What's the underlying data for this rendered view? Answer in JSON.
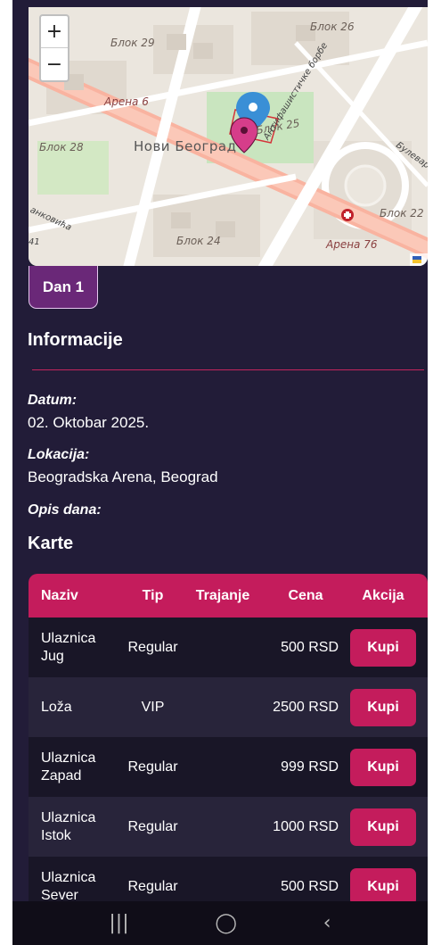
{
  "map": {
    "labels": {
      "blok29": "Блок 29",
      "blok26": "Блок 26",
      "blok28": "Блок 28",
      "blok24": "Блок 24",
      "blok22": "Блок 22",
      "blok25": "Блок 25",
      "arena6": "Арена 6",
      "arena76": "Арена 76",
      "novi_beograd": "Нови Београд",
      "antifasisticke": "Антифашистичке борбе",
      "bulevar_zorana": "Булевар зо",
      "jankovica": "анковића",
      "num41": "41"
    },
    "zoom_in": "+",
    "zoom_out": "−",
    "colors": {
      "marker_blue": "#3a8fd6",
      "marker_pink": "#d63d8a",
      "road": "#f9b3a0"
    }
  },
  "day_tab": {
    "label": "Dan 1"
  },
  "info": {
    "title": "Informacije",
    "date_label": "Datum:",
    "date_value": "02. Oktobar 2025.",
    "location_label": "Lokacija:",
    "location_value": "Beogradska Arena, Beograd",
    "description_label": "Opis dana:"
  },
  "tickets": {
    "title": "Karte",
    "columns": [
      "Naziv",
      "Tip",
      "Trajanje",
      "Cena",
      "Akcija"
    ],
    "rows": [
      {
        "name_1": "Ulaznica",
        "name_2": "Jug",
        "tip": "Regular",
        "trajanje": "",
        "cena": "500 RSD",
        "action": "Kupi"
      },
      {
        "name_1": "Loža",
        "name_2": "",
        "tip": "VIP",
        "trajanje": "",
        "cena": "2500 RSD",
        "action": "Kupi"
      },
      {
        "name_1": "Ulaznica",
        "name_2": "Zapad",
        "tip": "Regular",
        "trajanje": "",
        "cena": "999 RSD",
        "action": "Kupi"
      },
      {
        "name_1": "Ulaznica",
        "name_2": "Istok",
        "tip": "Regular",
        "trajanje": "",
        "cena": "1000 RSD",
        "action": "Kupi"
      },
      {
        "name_1": "Ulaznica",
        "name_2": "Sever",
        "tip": "Regular",
        "trajanje": "",
        "cena": "500 RSD",
        "action": "Kupi"
      }
    ]
  },
  "navbar": {
    "recents": "|||",
    "home": "◯",
    "back": "‹"
  },
  "colors": {
    "background": "#221c38",
    "accent": "#c41c5c",
    "tab": "#6a2878"
  }
}
